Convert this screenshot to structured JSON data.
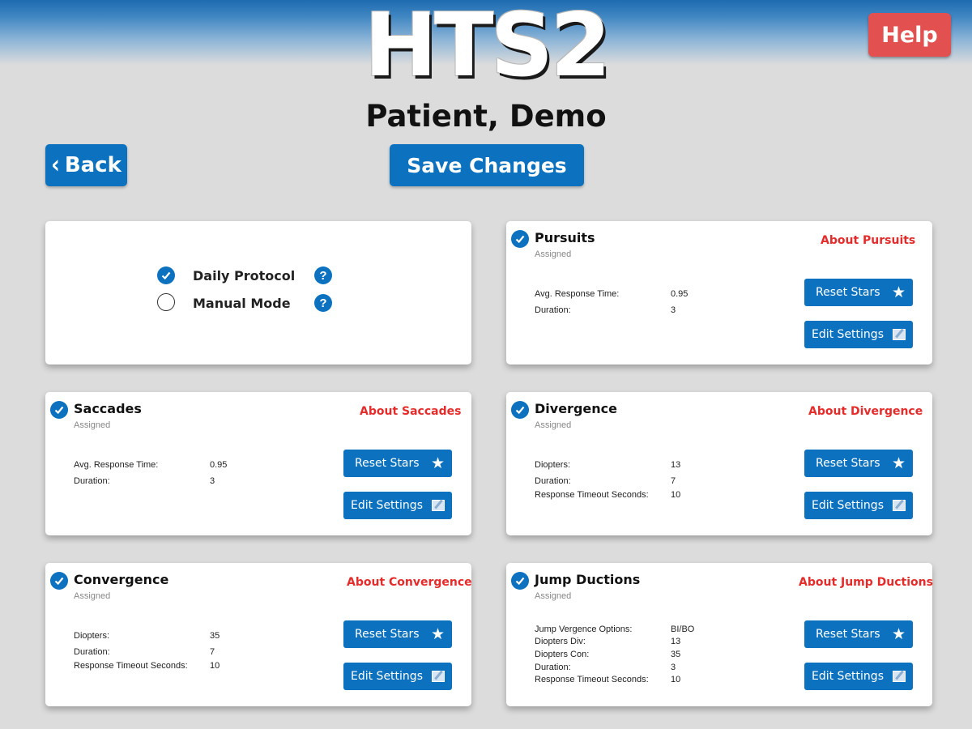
{
  "app": {
    "logo": "HTS2",
    "patient_name": "Patient, Demo"
  },
  "header": {
    "help_label": "Help",
    "back_label": "Back",
    "save_label": "Save Changes"
  },
  "mode": {
    "options": [
      {
        "label": "Daily Protocol",
        "selected": true
      },
      {
        "label": "Manual Mode",
        "selected": false
      }
    ],
    "help_glyph": "?"
  },
  "common": {
    "assigned_label": "Assigned",
    "reset_label": "Reset Stars",
    "edit_label": "Edit Settings"
  },
  "exercises": [
    {
      "title": "Pursuits",
      "about": "About Pursuits",
      "params": [
        {
          "label": "Avg. Response Time:",
          "value": "0.95"
        },
        {
          "label": "Duration:",
          "value": "3"
        }
      ]
    },
    {
      "title": "Saccades",
      "about": "About Saccades",
      "params": [
        {
          "label": "Avg. Response Time:",
          "value": "0.95"
        },
        {
          "label": "Duration:",
          "value": "3"
        }
      ]
    },
    {
      "title": "Divergence",
      "about": "About Divergence",
      "params": [
        {
          "label": "Diopters:",
          "value": "13"
        },
        {
          "label": "Duration:",
          "value": "7"
        },
        {
          "label": "Response Timeout Seconds:",
          "value": "10"
        }
      ]
    },
    {
      "title": "Convergence",
      "about": "About Convergence",
      "params": [
        {
          "label": "Diopters:",
          "value": "35"
        },
        {
          "label": "Duration:",
          "value": "7"
        },
        {
          "label": "Response Timeout Seconds:",
          "value": "10"
        }
      ]
    },
    {
      "title": "Jump Ductions",
      "about": "About Jump Ductions",
      "params": [
        {
          "label": "Jump Vergence Options:",
          "value": "BI/BO"
        },
        {
          "label": "Diopters Div:",
          "value": "13"
        },
        {
          "label": "Diopters Con:",
          "value": "35"
        },
        {
          "label": "Duration:",
          "value": "3"
        },
        {
          "label": "Response Timeout Seconds:",
          "value": "10"
        }
      ]
    }
  ],
  "colors": {
    "primary": "#0c72c0",
    "help": "#e25050",
    "link": "#e62b2b",
    "background": "#dcdcdc"
  }
}
